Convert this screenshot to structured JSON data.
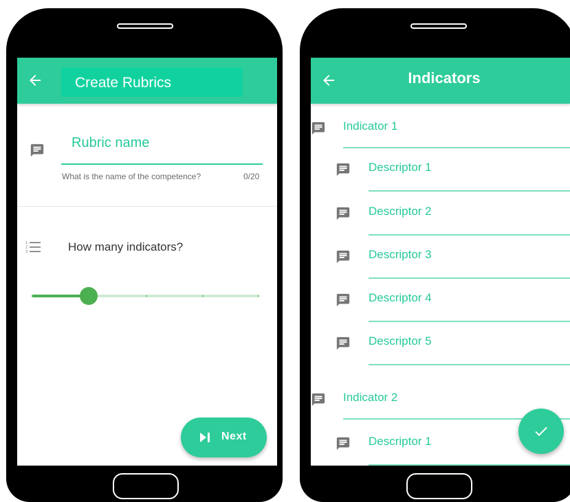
{
  "colors": {
    "accent": "#2ecc9a",
    "accent_text": "#26c99a",
    "slider": "#4caf50",
    "device": "#000000"
  },
  "left_screen": {
    "appbar": {
      "back_icon": "arrow-left-icon",
      "title": "Create Rubrics"
    },
    "rubric_field": {
      "icon": "message-icon",
      "label": "Rubric name",
      "helper": "What is the name of the competence?",
      "counter": "0/20"
    },
    "indicators_question": {
      "icon": "numbered-list-icon",
      "label": "How many indicators?"
    },
    "slider": {
      "min": 1,
      "max": 5,
      "value": 2
    },
    "next_button": {
      "icon": "skip-next-icon",
      "label": "Next"
    }
  },
  "right_screen": {
    "appbar": {
      "back_icon": "arrow-left-icon",
      "title": "Indicators"
    },
    "items": [
      {
        "type": "indicator",
        "label": "Indicator 1"
      },
      {
        "type": "descriptor",
        "label": "Descriptor  1"
      },
      {
        "type": "descriptor",
        "label": "Descriptor  2"
      },
      {
        "type": "descriptor",
        "label": "Descriptor  3"
      },
      {
        "type": "descriptor",
        "label": "Descriptor  4"
      },
      {
        "type": "descriptor",
        "label": "Descriptor  5"
      },
      {
        "type": "indicator",
        "label": "Indicator 2"
      },
      {
        "type": "descriptor",
        "label": "Descriptor  1"
      }
    ],
    "fab": {
      "icon": "check-icon"
    }
  }
}
